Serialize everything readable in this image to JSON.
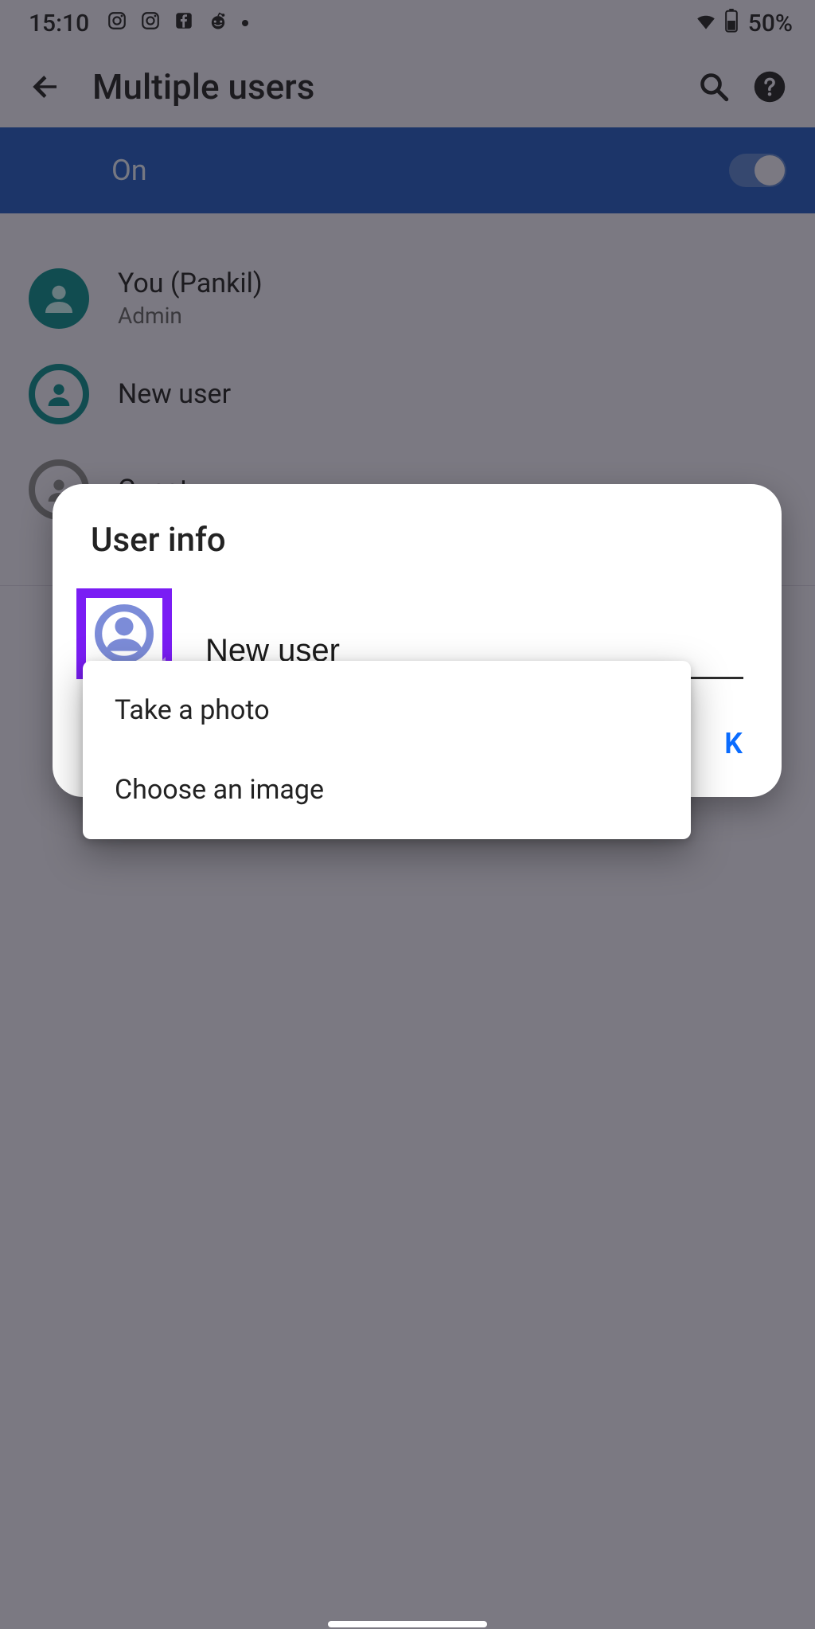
{
  "statusbar": {
    "time": "15:10",
    "battery_text": "50%"
  },
  "appbar": {
    "title": "Multiple users"
  },
  "toggle": {
    "label": "On",
    "state": true
  },
  "users": [
    {
      "name": "You (Pankil)",
      "role": "Admin"
    },
    {
      "name": "New user",
      "role": ""
    },
    {
      "name": "Guest",
      "role": ""
    }
  ],
  "dialog": {
    "title": "User info",
    "name_value": "New user",
    "ok_label": "OK",
    "ok_visible_fragment": "K"
  },
  "photo_menu": {
    "items": [
      "Take a photo",
      "Choose an image"
    ]
  },
  "colors": {
    "accent_blue": "#1b55c1",
    "link_blue": "#0a6cff",
    "purple_highlight": "#7a1df4",
    "teal": "#008a8a"
  }
}
